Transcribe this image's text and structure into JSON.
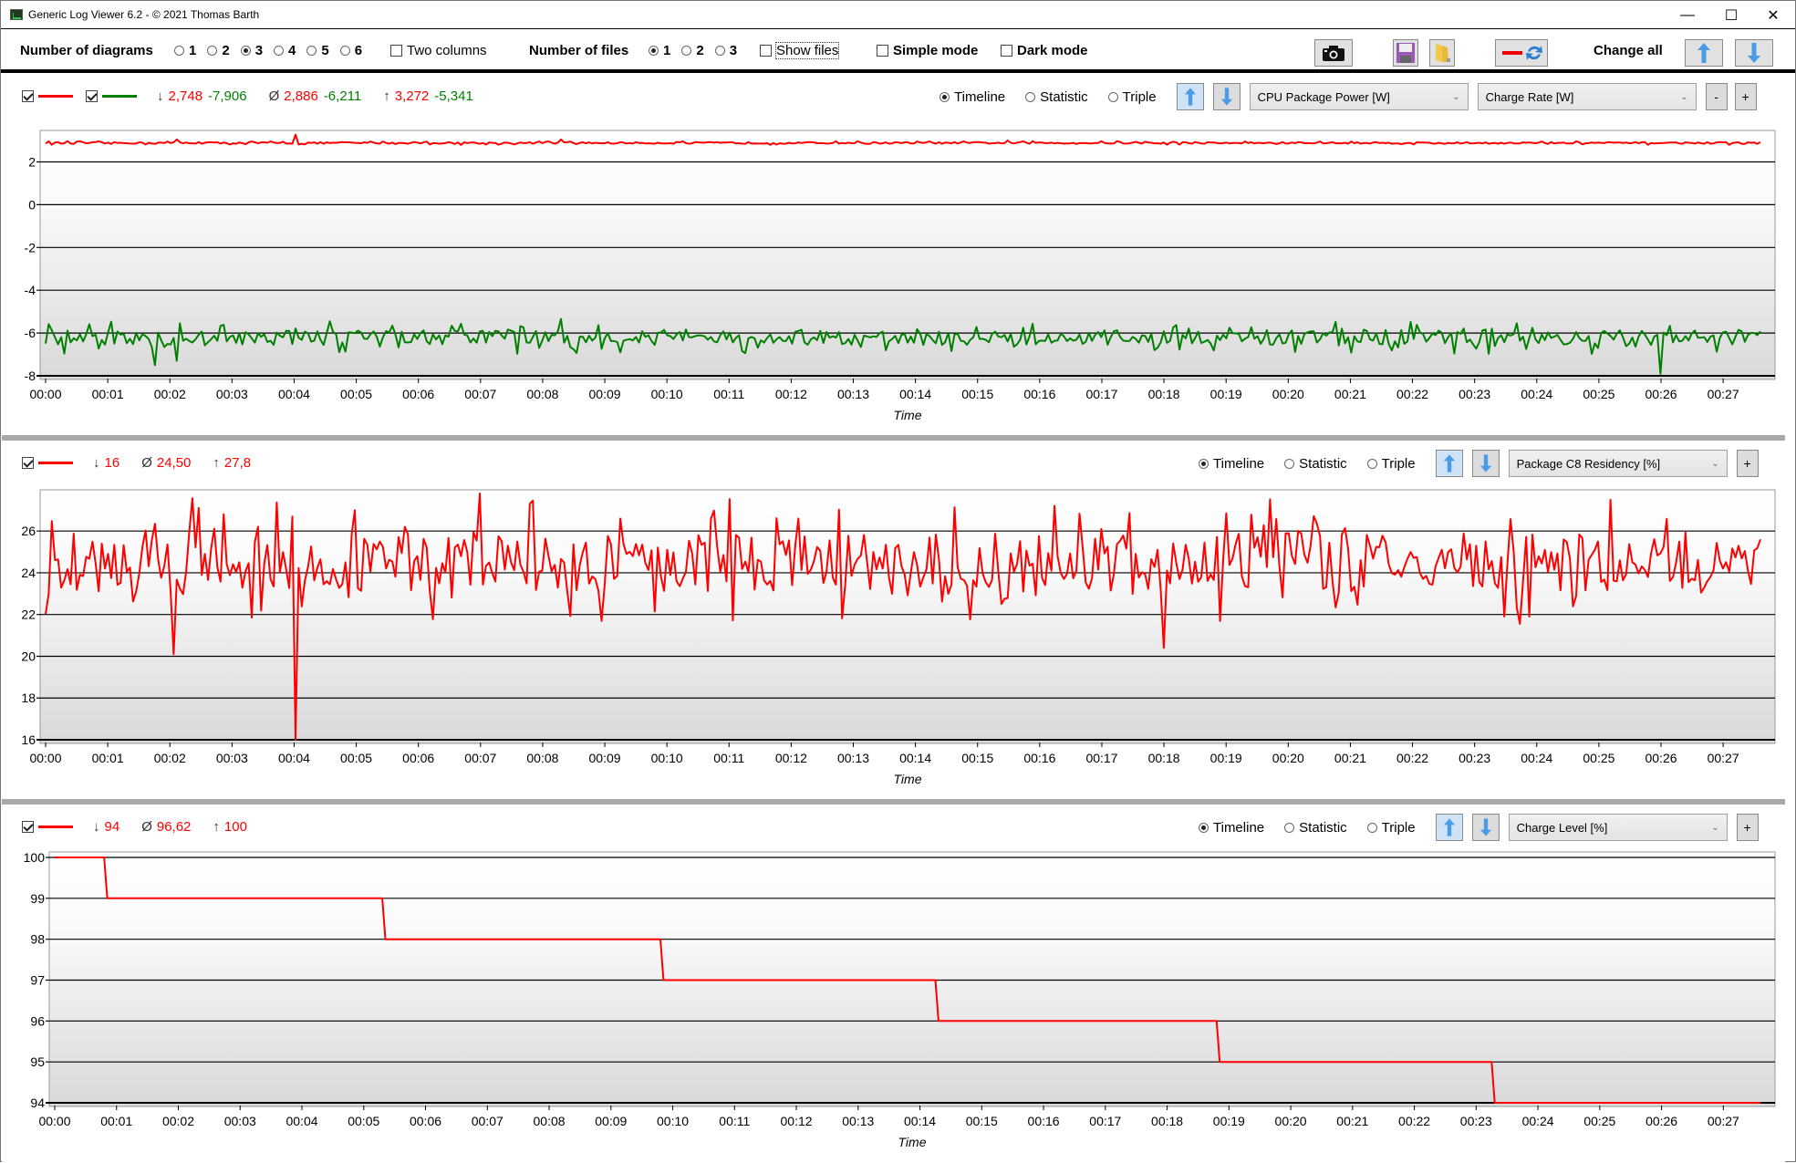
{
  "window": {
    "title": "Generic Log Viewer 6.2 - © 2021 Thomas Barth",
    "icon": "chart-app-icon",
    "controls": {
      "minimize": "—",
      "maximize": "☐",
      "close": "✕"
    }
  },
  "toolbar": {
    "diagrams_label": "Number of diagrams",
    "diagram_options": [
      "1",
      "2",
      "3",
      "4",
      "5",
      "6"
    ],
    "diagram_selected": "3",
    "two_columns_label": "Two columns",
    "two_columns_checked": false,
    "files_label": "Number of files",
    "file_options": [
      "1",
      "2",
      "3"
    ],
    "file_selected": "1",
    "show_files_label": "Show files",
    "show_files_checked": false,
    "simple_mode_label": "Simple mode",
    "simple_mode_checked": false,
    "dark_mode_label": "Dark mode",
    "dark_mode_checked": false,
    "change_all_label": "Change all",
    "buttons": [
      "camera-icon",
      "save-icon",
      "folder-icon",
      "swap-color-icon",
      "arrow-up-icon",
      "arrow-down-icon"
    ]
  },
  "view_modes": [
    "Timeline",
    "Statistic",
    "Triple"
  ],
  "panels": [
    {
      "series": [
        {
          "name": "CPU Package Power [W]",
          "color": "#ff0000",
          "checked": true,
          "min": "2,748",
          "avg": "2,886",
          "max": "3,272"
        },
        {
          "name": "Charge Rate [W]",
          "color": "#008000",
          "checked": true,
          "min": "-7,906",
          "avg": "-6,211",
          "max": "-5,341"
        }
      ],
      "min_symbol": "↓",
      "avg_symbol": "Ø",
      "max_symbol": "↑",
      "view_selected": "Timeline",
      "selects": [
        "CPU Package Power [W]",
        "Charge Rate [W]"
      ],
      "buttons": [
        "-",
        "+"
      ]
    },
    {
      "series": [
        {
          "name": "Package C8 Residency [%]",
          "color": "#ff0000",
          "checked": true,
          "min": "16",
          "avg": "24,50",
          "max": "27,8"
        }
      ],
      "min_symbol": "↓",
      "avg_symbol": "Ø",
      "max_symbol": "↑",
      "view_selected": "Timeline",
      "selects": [
        "Package C8 Residency [%]"
      ],
      "buttons": [
        "+"
      ]
    },
    {
      "series": [
        {
          "name": "Charge Level [%]",
          "color": "#ff0000",
          "checked": true,
          "min": "94",
          "avg": "96,62",
          "max": "100"
        }
      ],
      "min_symbol": "↓",
      "avg_symbol": "Ø",
      "max_symbol": "↑",
      "view_selected": "Timeline",
      "selects": [
        "Charge Level [%]"
      ],
      "buttons": [
        "+"
      ]
    }
  ],
  "chart_data": [
    {
      "type": "line",
      "title": "CPU Package Power [W] / Charge Rate [W]",
      "xlabel": "Time",
      "ylabel": "",
      "x_unit": "minutes",
      "xlim": [
        0,
        27.6
      ],
      "ylim": [
        -8,
        3.3
      ],
      "yticks": [
        2,
        0,
        -2,
        -4,
        -6,
        -8
      ],
      "xticks": [
        "00:00",
        "00:01",
        "00:02",
        "00:03",
        "00:04",
        "00:05",
        "00:06",
        "00:07",
        "00:08",
        "00:09",
        "00:10",
        "00:11",
        "00:12",
        "00:13",
        "00:14",
        "00:15",
        "00:16",
        "00:17",
        "00:18",
        "00:19",
        "00:20",
        "00:21",
        "00:22",
        "00:23",
        "00:24",
        "00:25",
        "00:26",
        "00:27"
      ],
      "grid": true,
      "series": [
        {
          "name": "CPU Package Power [W]",
          "color": "#ff0000",
          "sample_count": 550,
          "baseline": 2.886,
          "noise": 0.04,
          "min": 2.748,
          "max": 3.272,
          "spikes": [
            [
              4.0,
              3.272
            ],
            [
              2.1,
              3.05
            ],
            [
              8.3,
              3.05
            ],
            [
              15.5,
              3.0
            ]
          ]
        },
        {
          "name": "Charge Rate [W]",
          "color": "#008000",
          "sample_count": 550,
          "baseline": -6.211,
          "noise": 0.35,
          "min": -7.906,
          "max": -5.341,
          "spikes": [
            [
              26.0,
              -7.906
            ],
            [
              1.75,
              -7.5
            ],
            [
              2.1,
              -7.3
            ],
            [
              4.6,
              -5.45
            ],
            [
              8.3,
              -5.34
            ]
          ]
        }
      ]
    },
    {
      "type": "line",
      "title": "Package C8 Residency [%]",
      "xlabel": "Time",
      "x_unit": "minutes",
      "xlim": [
        0,
        27.6
      ],
      "ylim": [
        16,
        27.8
      ],
      "yticks": [
        26,
        24,
        22,
        20,
        18,
        16
      ],
      "xticks": [
        "00:00",
        "00:01",
        "00:02",
        "00:03",
        "00:04",
        "00:05",
        "00:06",
        "00:07",
        "00:08",
        "00:09",
        "00:10",
        "00:11",
        "00:12",
        "00:13",
        "00:14",
        "00:15",
        "00:16",
        "00:17",
        "00:18",
        "00:19",
        "00:20",
        "00:21",
        "00:22",
        "00:23",
        "00:24",
        "00:25",
        "00:26",
        "00:27"
      ],
      "grid": true,
      "series": [
        {
          "name": "Package C8 Residency [%]",
          "color": "#ff0000",
          "sample_count": 550,
          "baseline": 24.5,
          "noise": 1.4,
          "min": 16,
          "max": 27.8,
          "spikes": [
            [
              4.0,
              16.0
            ],
            [
              2.05,
              20.1
            ],
            [
              18.0,
              20.4
            ],
            [
              7.0,
              27.8
            ],
            [
              25.2,
              27.5
            ],
            [
              0.05,
              23.0
            ]
          ]
        }
      ]
    },
    {
      "type": "line",
      "title": "Charge Level [%]",
      "xlabel": "Time",
      "x_unit": "minutes",
      "xlim": [
        0,
        27.6
      ],
      "ylim": [
        94,
        100
      ],
      "yticks": [
        100,
        99,
        98,
        97,
        96,
        95,
        94
      ],
      "xticks": [
        "00:00",
        "00:01",
        "00:02",
        "00:03",
        "00:04",
        "00:05",
        "00:06",
        "00:07",
        "00:08",
        "00:09",
        "00:10",
        "00:11",
        "00:12",
        "00:13",
        "00:14",
        "00:15",
        "00:16",
        "00:17",
        "00:18",
        "00:19",
        "00:20",
        "00:21",
        "00:22",
        "00:23",
        "00:24",
        "00:25",
        "00:26",
        "00:27"
      ],
      "grid": true,
      "series": [
        {
          "name": "Charge Level [%]",
          "color": "#ff0000",
          "step": true,
          "points": [
            [
              0,
              100
            ],
            [
              0.8,
              100
            ],
            [
              0.85,
              99
            ],
            [
              5.3,
              99
            ],
            [
              5.35,
              98
            ],
            [
              9.8,
              98
            ],
            [
              9.85,
              97
            ],
            [
              14.25,
              97
            ],
            [
              14.3,
              96
            ],
            [
              18.8,
              96
            ],
            [
              18.85,
              95
            ],
            [
              23.25,
              95
            ],
            [
              23.3,
              94
            ],
            [
              27.6,
              94
            ]
          ]
        }
      ]
    }
  ]
}
